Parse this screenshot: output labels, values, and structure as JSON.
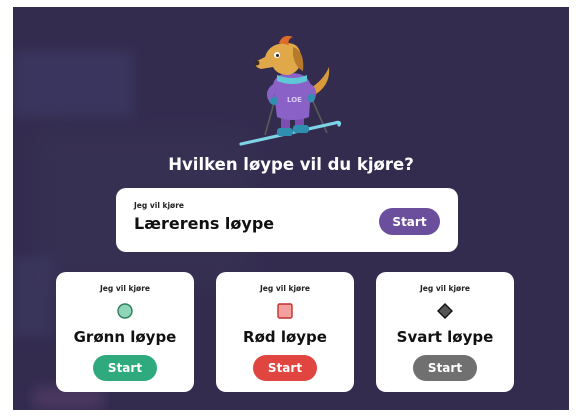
{
  "colors": {
    "background": "#332c4f",
    "card": "#ffffff",
    "teacher_button": "#6c4f9c",
    "green": "#2faa7e",
    "red": "#e0453f",
    "black_button": "#707070"
  },
  "mascot": {
    "icon": "skiing-dog-mascot",
    "shirt_text": "LOE"
  },
  "question": "Hvilken løype vil du kjøre?",
  "teacher_track": {
    "prefix": "Jeg vil kjøre",
    "title": "Lærerens løype",
    "button": "Start"
  },
  "tracks": [
    {
      "prefix": "Jeg vil kjøre",
      "title": "Grønn løype",
      "button": "Start",
      "icon": "green-circle-icon",
      "color": "#2faa7e"
    },
    {
      "prefix": "Jeg vil kjøre",
      "title": "Rød løype",
      "button": "Start",
      "icon": "red-square-icon",
      "color": "#e0453f"
    },
    {
      "prefix": "Jeg vil kjøre",
      "title": "Svart løype",
      "button": "Start",
      "icon": "black-diamond-icon",
      "color": "#707070"
    }
  ]
}
